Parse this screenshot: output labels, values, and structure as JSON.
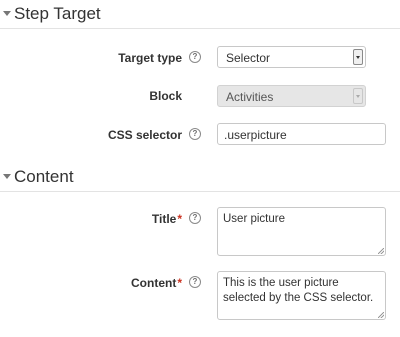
{
  "sections": {
    "step_target": {
      "title": "Step Target"
    },
    "content": {
      "title": "Content"
    }
  },
  "fields": {
    "target_type": {
      "label": "Target type",
      "value": "Selector",
      "help_icon": "question-circle-icon"
    },
    "block": {
      "label": "Block",
      "value": "Activities"
    },
    "css_selector": {
      "label": "CSS selector",
      "value": ".userpicture",
      "help_icon": "question-circle-icon"
    },
    "title": {
      "label": "Title",
      "required_mark": "*",
      "value": "User picture",
      "help_icon": "question-circle-icon"
    },
    "content": {
      "label": "Content",
      "required_mark": "*",
      "value": "This is the user picture selected by the CSS selector.",
      "help_icon": "question-circle-icon"
    }
  },
  "colors": {
    "required": "#ca3120",
    "text": "#333333",
    "border": "#c8c8c8",
    "disabled_bg": "#e6e6e6"
  }
}
